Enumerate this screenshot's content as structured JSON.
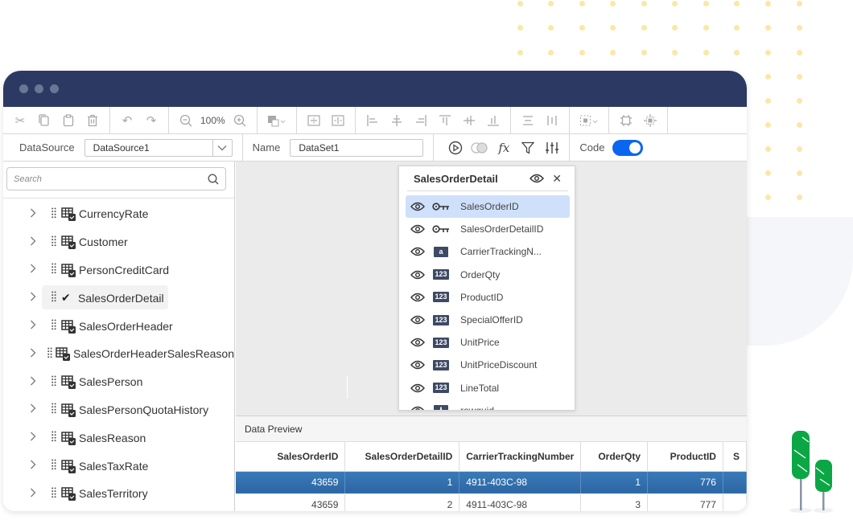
{
  "window": {
    "title_dots": [
      "close",
      "minimize",
      "maximize"
    ]
  },
  "toolbar": {
    "groups": [
      [
        "cut-icon",
        "copy-icon",
        "paste-icon",
        "delete-icon"
      ],
      [
        "undo-icon",
        "redo-icon"
      ],
      [
        "zoom-out-icon",
        "zoom-in-icon"
      ],
      [
        "fill-color-icon"
      ],
      [
        "split-horizontal-icon",
        "split-vertical-icon"
      ],
      [
        "align-left-icon",
        "align-center-icon",
        "align-right-icon",
        "align-top-icon",
        "align-middle-icon",
        "align-bottom-icon"
      ],
      [
        "distribute-horizontal-icon",
        "distribute-vertical-icon"
      ],
      [
        "selection-icon"
      ],
      [
        "size-to-fit-icon",
        "center-icon"
      ]
    ],
    "zoom_level": "100%"
  },
  "properties": {
    "datasource_label": "DataSource",
    "datasource_value": "DataSource1",
    "name_label": "Name",
    "name_value": "DataSet1",
    "code_label": "Code",
    "code_enabled": true,
    "accent_color": "#0a66f0"
  },
  "left_panel": {
    "search_placeholder": "Search",
    "tables": [
      {
        "name": "CurrencyRate",
        "selected": false
      },
      {
        "name": "Customer",
        "selected": false
      },
      {
        "name": "PersonCreditCard",
        "selected": false
      },
      {
        "name": "SalesOrderDetail",
        "selected": true
      },
      {
        "name": "SalesOrderHeader",
        "selected": false
      },
      {
        "name": "SalesOrderHeaderSalesReason",
        "selected": false
      },
      {
        "name": "SalesPerson",
        "selected": false
      },
      {
        "name": "SalesPersonQuotaHistory",
        "selected": false
      },
      {
        "name": "SalesReason",
        "selected": false
      },
      {
        "name": "SalesTaxRate",
        "selected": false
      },
      {
        "name": "SalesTerritory",
        "selected": false
      }
    ]
  },
  "field_popup": {
    "title": "SalesOrderDetail",
    "fields": [
      {
        "name": "SalesOrderID",
        "type": "key",
        "selected": true
      },
      {
        "name": "SalesOrderDetailID",
        "type": "key",
        "selected": false
      },
      {
        "name": "CarrierTrackingN...",
        "type": "a",
        "selected": false
      },
      {
        "name": "OrderQty",
        "type": "123",
        "selected": false
      },
      {
        "name": "ProductID",
        "type": "123",
        "selected": false
      },
      {
        "name": "SpecialOfferID",
        "type": "123",
        "selected": false
      },
      {
        "name": "UnitPrice",
        "type": "123",
        "selected": false
      },
      {
        "name": "UnitPriceDiscount",
        "type": "123",
        "selected": false
      },
      {
        "name": "LineTotal",
        "type": "123",
        "selected": false
      },
      {
        "name": "rowguid",
        "type": "guid",
        "selected": false
      }
    ]
  },
  "data_preview": {
    "title": "Data Preview",
    "columns": [
      "SalesOrderID",
      "SalesOrderDetailID",
      "CarrierTrackingNumber",
      "OrderQty",
      "ProductID",
      "S"
    ],
    "rows": [
      [
        "43659",
        "1",
        "4911-403C-98",
        "1",
        "776",
        ""
      ],
      [
        "43659",
        "2",
        "4911-403C-98",
        "3",
        "777",
        ""
      ]
    ],
    "selected_row": 0
  }
}
